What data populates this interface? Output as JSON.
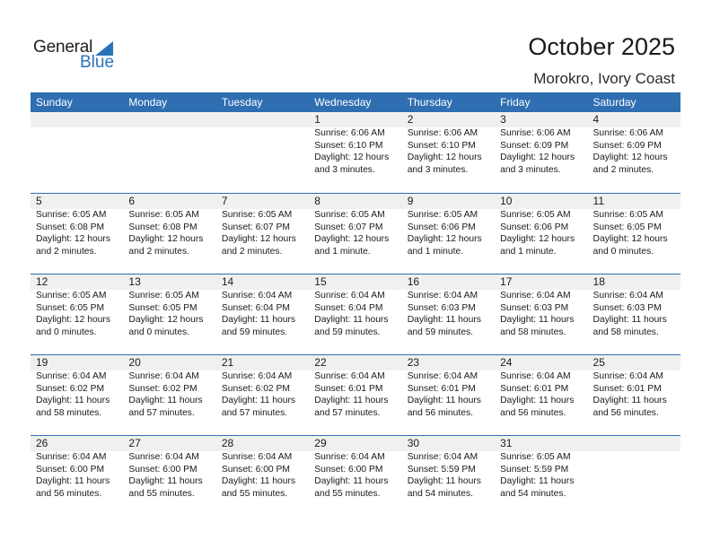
{
  "logo": {
    "word1": "General",
    "word2": "Blue"
  },
  "header": {
    "title": "October 2025",
    "location": "Morokro, Ivory Coast"
  },
  "colors": {
    "accent": "#2f6eb1",
    "band": "#f0f0f0"
  },
  "weekdays": [
    "Sunday",
    "Monday",
    "Tuesday",
    "Wednesday",
    "Thursday",
    "Friday",
    "Saturday"
  ],
  "weeks": [
    [
      null,
      null,
      null,
      {
        "day": "1",
        "sunrise": "Sunrise: 6:06 AM",
        "sunset": "Sunset: 6:10 PM",
        "daylight1": "Daylight: 12 hours",
        "daylight2": "and 3 minutes."
      },
      {
        "day": "2",
        "sunrise": "Sunrise: 6:06 AM",
        "sunset": "Sunset: 6:10 PM",
        "daylight1": "Daylight: 12 hours",
        "daylight2": "and 3 minutes."
      },
      {
        "day": "3",
        "sunrise": "Sunrise: 6:06 AM",
        "sunset": "Sunset: 6:09 PM",
        "daylight1": "Daylight: 12 hours",
        "daylight2": "and 3 minutes."
      },
      {
        "day": "4",
        "sunrise": "Sunrise: 6:06 AM",
        "sunset": "Sunset: 6:09 PM",
        "daylight1": "Daylight: 12 hours",
        "daylight2": "and 2 minutes."
      }
    ],
    [
      {
        "day": "5",
        "sunrise": "Sunrise: 6:05 AM",
        "sunset": "Sunset: 6:08 PM",
        "daylight1": "Daylight: 12 hours",
        "daylight2": "and 2 minutes."
      },
      {
        "day": "6",
        "sunrise": "Sunrise: 6:05 AM",
        "sunset": "Sunset: 6:08 PM",
        "daylight1": "Daylight: 12 hours",
        "daylight2": "and 2 minutes."
      },
      {
        "day": "7",
        "sunrise": "Sunrise: 6:05 AM",
        "sunset": "Sunset: 6:07 PM",
        "daylight1": "Daylight: 12 hours",
        "daylight2": "and 2 minutes."
      },
      {
        "day": "8",
        "sunrise": "Sunrise: 6:05 AM",
        "sunset": "Sunset: 6:07 PM",
        "daylight1": "Daylight: 12 hours",
        "daylight2": "and 1 minute."
      },
      {
        "day": "9",
        "sunrise": "Sunrise: 6:05 AM",
        "sunset": "Sunset: 6:06 PM",
        "daylight1": "Daylight: 12 hours",
        "daylight2": "and 1 minute."
      },
      {
        "day": "10",
        "sunrise": "Sunrise: 6:05 AM",
        "sunset": "Sunset: 6:06 PM",
        "daylight1": "Daylight: 12 hours",
        "daylight2": "and 1 minute."
      },
      {
        "day": "11",
        "sunrise": "Sunrise: 6:05 AM",
        "sunset": "Sunset: 6:05 PM",
        "daylight1": "Daylight: 12 hours",
        "daylight2": "and 0 minutes."
      }
    ],
    [
      {
        "day": "12",
        "sunrise": "Sunrise: 6:05 AM",
        "sunset": "Sunset: 6:05 PM",
        "daylight1": "Daylight: 12 hours",
        "daylight2": "and 0 minutes."
      },
      {
        "day": "13",
        "sunrise": "Sunrise: 6:05 AM",
        "sunset": "Sunset: 6:05 PM",
        "daylight1": "Daylight: 12 hours",
        "daylight2": "and 0 minutes."
      },
      {
        "day": "14",
        "sunrise": "Sunrise: 6:04 AM",
        "sunset": "Sunset: 6:04 PM",
        "daylight1": "Daylight: 11 hours",
        "daylight2": "and 59 minutes."
      },
      {
        "day": "15",
        "sunrise": "Sunrise: 6:04 AM",
        "sunset": "Sunset: 6:04 PM",
        "daylight1": "Daylight: 11 hours",
        "daylight2": "and 59 minutes."
      },
      {
        "day": "16",
        "sunrise": "Sunrise: 6:04 AM",
        "sunset": "Sunset: 6:03 PM",
        "daylight1": "Daylight: 11 hours",
        "daylight2": "and 59 minutes."
      },
      {
        "day": "17",
        "sunrise": "Sunrise: 6:04 AM",
        "sunset": "Sunset: 6:03 PM",
        "daylight1": "Daylight: 11 hours",
        "daylight2": "and 58 minutes."
      },
      {
        "day": "18",
        "sunrise": "Sunrise: 6:04 AM",
        "sunset": "Sunset: 6:03 PM",
        "daylight1": "Daylight: 11 hours",
        "daylight2": "and 58 minutes."
      }
    ],
    [
      {
        "day": "19",
        "sunrise": "Sunrise: 6:04 AM",
        "sunset": "Sunset: 6:02 PM",
        "daylight1": "Daylight: 11 hours",
        "daylight2": "and 58 minutes."
      },
      {
        "day": "20",
        "sunrise": "Sunrise: 6:04 AM",
        "sunset": "Sunset: 6:02 PM",
        "daylight1": "Daylight: 11 hours",
        "daylight2": "and 57 minutes."
      },
      {
        "day": "21",
        "sunrise": "Sunrise: 6:04 AM",
        "sunset": "Sunset: 6:02 PM",
        "daylight1": "Daylight: 11 hours",
        "daylight2": "and 57 minutes."
      },
      {
        "day": "22",
        "sunrise": "Sunrise: 6:04 AM",
        "sunset": "Sunset: 6:01 PM",
        "daylight1": "Daylight: 11 hours",
        "daylight2": "and 57 minutes."
      },
      {
        "day": "23",
        "sunrise": "Sunrise: 6:04 AM",
        "sunset": "Sunset: 6:01 PM",
        "daylight1": "Daylight: 11 hours",
        "daylight2": "and 56 minutes."
      },
      {
        "day": "24",
        "sunrise": "Sunrise: 6:04 AM",
        "sunset": "Sunset: 6:01 PM",
        "daylight1": "Daylight: 11 hours",
        "daylight2": "and 56 minutes."
      },
      {
        "day": "25",
        "sunrise": "Sunrise: 6:04 AM",
        "sunset": "Sunset: 6:01 PM",
        "daylight1": "Daylight: 11 hours",
        "daylight2": "and 56 minutes."
      }
    ],
    [
      {
        "day": "26",
        "sunrise": "Sunrise: 6:04 AM",
        "sunset": "Sunset: 6:00 PM",
        "daylight1": "Daylight: 11 hours",
        "daylight2": "and 56 minutes."
      },
      {
        "day": "27",
        "sunrise": "Sunrise: 6:04 AM",
        "sunset": "Sunset: 6:00 PM",
        "daylight1": "Daylight: 11 hours",
        "daylight2": "and 55 minutes."
      },
      {
        "day": "28",
        "sunrise": "Sunrise: 6:04 AM",
        "sunset": "Sunset: 6:00 PM",
        "daylight1": "Daylight: 11 hours",
        "daylight2": "and 55 minutes."
      },
      {
        "day": "29",
        "sunrise": "Sunrise: 6:04 AM",
        "sunset": "Sunset: 6:00 PM",
        "daylight1": "Daylight: 11 hours",
        "daylight2": "and 55 minutes."
      },
      {
        "day": "30",
        "sunrise": "Sunrise: 6:04 AM",
        "sunset": "Sunset: 5:59 PM",
        "daylight1": "Daylight: 11 hours",
        "daylight2": "and 54 minutes."
      },
      {
        "day": "31",
        "sunrise": "Sunrise: 6:05 AM",
        "sunset": "Sunset: 5:59 PM",
        "daylight1": "Daylight: 11 hours",
        "daylight2": "and 54 minutes."
      },
      null
    ]
  ]
}
